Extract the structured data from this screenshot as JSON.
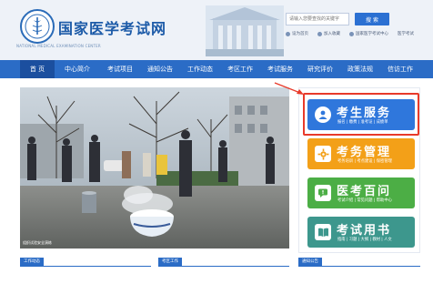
{
  "header": {
    "site_title": "国家医学考试网",
    "logo_subtitle": "NATIONAL MEDICAL EXAMINATION CENTER",
    "search_placeholder": "请输入您要查找的关键字",
    "search_button": "搜 索",
    "top_links": [
      "设为首页",
      "加入收藏",
      "国家医学考试中心",
      "医学考试"
    ]
  },
  "nav": {
    "items": [
      "首 页",
      "中心简介",
      "考试项目",
      "通知公告",
      "工作动态",
      "考区工作",
      "考试服务",
      "研究评价",
      "政策法规",
      "信访工作"
    ],
    "active_index": 0
  },
  "hero": {
    "caption": "组织试验安全演练"
  },
  "services": [
    {
      "title": "考生服务",
      "subtitle": "报名 | 缴费 | 准考证 | 成绩单",
      "color": "#2f77dc",
      "icon": "person-icon"
    },
    {
      "title": "考务管理",
      "subtitle": "考务培训 | 考点建设 | 保密管理",
      "color": "#f3a018",
      "icon": "gear-icon"
    },
    {
      "title": "医考百问",
      "subtitle": "考试介绍 | 常见问题 | 帮助中心",
      "color": "#4cae45",
      "icon": "chat-icon"
    },
    {
      "title": "考试用书",
      "subtitle": "指南 | 习题 | 大纲 | 教材 | 人文",
      "color": "#3d978d",
      "icon": "book-icon"
    }
  ],
  "bottom_tabs": [
    "工作动态",
    "考区工作",
    "通知公告"
  ],
  "colors": {
    "brand_blue": "#2b6cc6",
    "highlight_red": "#e83a2a"
  }
}
